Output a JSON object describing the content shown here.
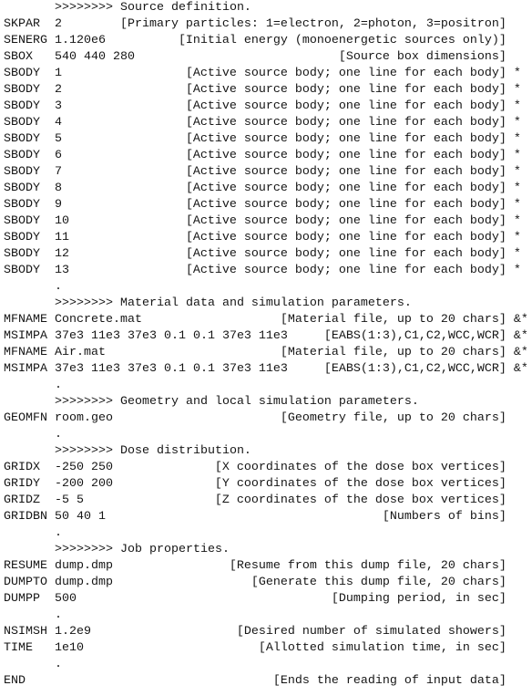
{
  "lines": [
    {
      "type": "header",
      "text": ">>>>>>>> Source definition."
    },
    {
      "key": "SKPAR",
      "value": "2",
      "comment": "[Primary particles: 1=electron, 2=photon, 3=positron]",
      "suffix": ""
    },
    {
      "key": "SENERG",
      "value": "1.120e6",
      "comment": "[Initial energy (monoenergetic sources only)]",
      "suffix": ""
    },
    {
      "key": "SBOX",
      "value": "540 440 280",
      "comment": "[Source box dimensions]",
      "suffix": ""
    },
    {
      "key": "SBODY",
      "value": "1",
      "comment": "[Active source body; one line for each body]",
      "suffix": " *"
    },
    {
      "key": "SBODY",
      "value": "2",
      "comment": "[Active source body; one line for each body]",
      "suffix": " *"
    },
    {
      "key": "SBODY",
      "value": "3",
      "comment": "[Active source body; one line for each body]",
      "suffix": " *"
    },
    {
      "key": "SBODY",
      "value": "4",
      "comment": "[Active source body; one line for each body]",
      "suffix": " *"
    },
    {
      "key": "SBODY",
      "value": "5",
      "comment": "[Active source body; one line for each body]",
      "suffix": " *"
    },
    {
      "key": "SBODY",
      "value": "6",
      "comment": "[Active source body; one line for each body]",
      "suffix": " *"
    },
    {
      "key": "SBODY",
      "value": "7",
      "comment": "[Active source body; one line for each body]",
      "suffix": " *"
    },
    {
      "key": "SBODY",
      "value": "8",
      "comment": "[Active source body; one line for each body]",
      "suffix": " *"
    },
    {
      "key": "SBODY",
      "value": "9",
      "comment": "[Active source body; one line for each body]",
      "suffix": " *"
    },
    {
      "key": "SBODY",
      "value": "10",
      "comment": "[Active source body; one line for each body]",
      "suffix": " *"
    },
    {
      "key": "SBODY",
      "value": "11",
      "comment": "[Active source body; one line for each body]",
      "suffix": " *"
    },
    {
      "key": "SBODY",
      "value": "12",
      "comment": "[Active source body; one line for each body]",
      "suffix": " *"
    },
    {
      "key": "SBODY",
      "value": "13",
      "comment": "[Active source body; one line for each body]",
      "suffix": " *"
    },
    {
      "type": "header",
      "text": "."
    },
    {
      "type": "header",
      "text": ">>>>>>>> Material data and simulation parameters."
    },
    {
      "key": "MFNAME",
      "value": "Concrete.mat",
      "comment": "[Material file, up to 20 chars]",
      "suffix": " &*"
    },
    {
      "key": "MSIMPA",
      "value": "37e3 11e3 37e3 0.1 0.1 37e3 11e3",
      "comment": "[EABS(1:3),C1,C2,WCC,WCR]",
      "suffix": " &*"
    },
    {
      "key": "MFNAME",
      "value": "Air.mat",
      "comment": "[Material file, up to 20 chars]",
      "suffix": " &*"
    },
    {
      "key": "MSIMPA",
      "value": "37e3 11e3 37e3 0.1 0.1 37e3 11e3",
      "comment": "[EABS(1:3),C1,C2,WCC,WCR]",
      "suffix": " &*"
    },
    {
      "type": "header",
      "text": "."
    },
    {
      "type": "header",
      "text": ">>>>>>>> Geometry and local simulation parameters."
    },
    {
      "key": "GEOMFN",
      "value": "room.geo",
      "comment": "[Geometry file, up to 20 chars]",
      "suffix": ""
    },
    {
      "type": "header",
      "text": "."
    },
    {
      "type": "header",
      "text": ">>>>>>>> Dose distribution."
    },
    {
      "key": "GRIDX",
      "value": "-250 250",
      "comment": "[X coordinates of the dose box vertices]",
      "suffix": ""
    },
    {
      "key": "GRIDY",
      "value": "-200 200",
      "comment": "[Y coordinates of the dose box vertices]",
      "suffix": ""
    },
    {
      "key": "GRIDZ",
      "value": "-5 5",
      "comment": "[Z coordinates of the dose box vertices]",
      "suffix": ""
    },
    {
      "key": "GRIDBN",
      "value": "50 40 1",
      "comment": "[Numbers of bins]",
      "suffix": ""
    },
    {
      "type": "header",
      "text": "."
    },
    {
      "type": "header",
      "text": ">>>>>>>> Job properties."
    },
    {
      "key": "RESUME",
      "value": "dump.dmp",
      "comment": "[Resume from this dump file, 20 chars]",
      "suffix": ""
    },
    {
      "key": "DUMPTO",
      "value": "dump.dmp",
      "comment": "[Generate this dump file, 20 chars]",
      "suffix": ""
    },
    {
      "key": "DUMPP",
      "value": "500",
      "comment": "[Dumping period, in sec]",
      "suffix": ""
    },
    {
      "type": "header",
      "text": "."
    },
    {
      "key": "NSIMSH",
      "value": "1.2e9",
      "comment": "[Desired number of simulated showers]",
      "suffix": ""
    },
    {
      "key": "TIME",
      "value": "1e10",
      "comment": "[Allotted simulation time, in sec]",
      "suffix": ""
    },
    {
      "type": "header",
      "text": "."
    },
    {
      "key": "END",
      "value": "",
      "comment": "[Ends the reading of input data]",
      "suffix": ""
    }
  ]
}
